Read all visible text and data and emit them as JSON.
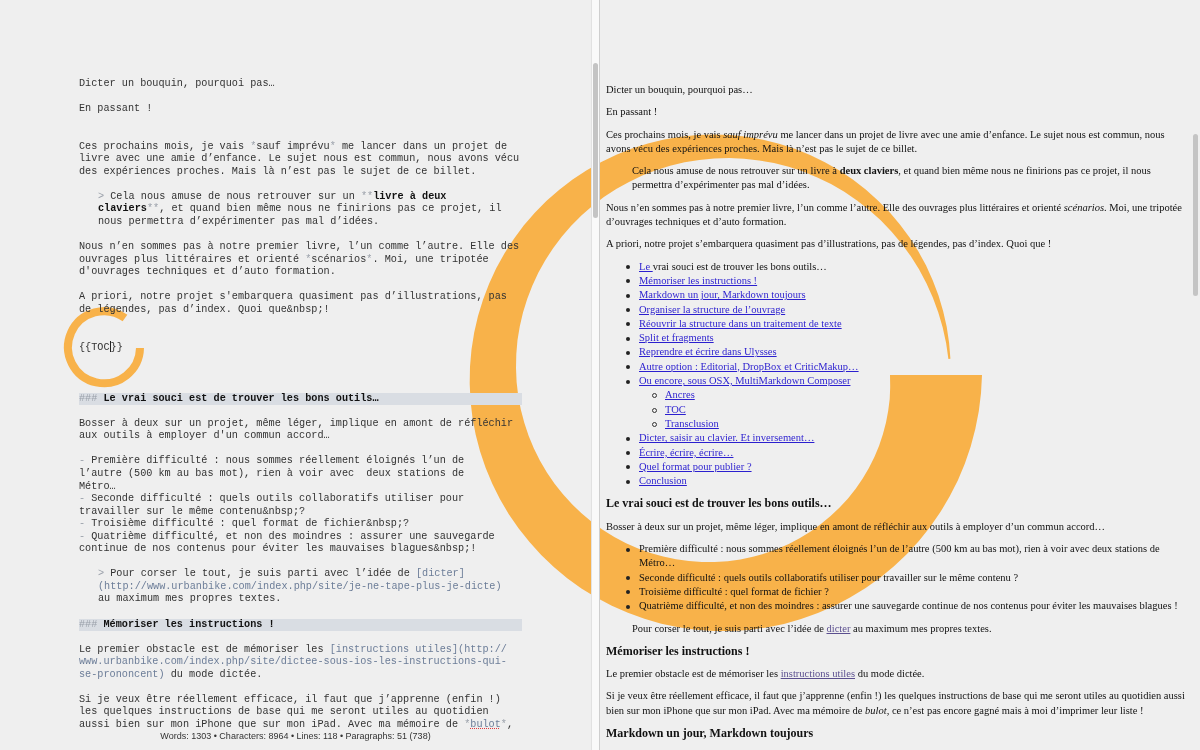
{
  "editor": {
    "blocks": [
      {
        "kind": "para",
        "lines": [
          "Dicter un bouquin, pourquoi pas…"
        ]
      },
      {
        "kind": "blank"
      },
      {
        "kind": "para",
        "lines": [
          "En passant !"
        ]
      },
      {
        "kind": "blank"
      },
      {
        "kind": "blank"
      },
      {
        "kind": "para",
        "lines": [
          [
            "Ces prochains mois, je vais ",
            {
              "text": "*",
              "kind": "mark"
            },
            "sauf imprévu",
            {
              "text": "*",
              "kind": "mark"
            },
            " me lancer dans un projet de"
          ],
          "livre avec une amie d’enfance. Le sujet nous est commun, nous avons vécu",
          "des expériences proches. Mais là n’est pas le sujet de ce billet."
        ]
      },
      {
        "kind": "blank"
      },
      {
        "kind": "quote",
        "lines": [
          [
            {
              "text": "> ",
              "kind": "mark"
            },
            "Cela nous amuse de nous retrouver sur un ",
            {
              "text": "**",
              "kind": "mark"
            },
            {
              "text": "livre à deux",
              "kind": "bold"
            }
          ],
          [
            {
              "text": "claviers",
              "kind": "bold"
            },
            {
              "text": "**",
              "kind": "mark"
            },
            ", et quand bien même nous ne finirions pas ce projet, il"
          ],
          "nous permettra d’expérimenter pas mal d’idées."
        ]
      },
      {
        "kind": "blank"
      },
      {
        "kind": "para",
        "lines": [
          "Nous n’en sommes pas à notre premier livre, l’un comme l’autre. Elle des",
          [
            "ouvrages plus littéraires et orienté ",
            {
              "text": "*",
              "kind": "mark"
            },
            "scénarios",
            {
              "text": "*",
              "kind": "mark"
            },
            ". Moi, une tripotée"
          ],
          "d'ouvrages techniques et d’auto formation."
        ]
      },
      {
        "kind": "blank"
      },
      {
        "kind": "para",
        "lines": [
          "A priori, notre projet s'embarquera quasiment pas d’illustrations, pas",
          "de légendes, pas d’index. Quoi que&nbsp;!"
        ]
      },
      {
        "kind": "blank"
      },
      {
        "kind": "blank"
      },
      {
        "kind": "para",
        "lines": [
          [
            "{{TOC",
            {
              "kind": "caret"
            },
            "}}"
          ]
        ]
      },
      {
        "kind": "blank"
      },
      {
        "kind": "blank"
      },
      {
        "kind": "blank"
      },
      {
        "kind": "heading",
        "lines": [
          [
            {
              "text": "### ",
              "kind": "mark"
            },
            {
              "text": "Le vrai souci est de trouver les bons outils…",
              "kind": "bold"
            }
          ]
        ]
      },
      {
        "kind": "blank"
      },
      {
        "kind": "para",
        "lines": [
          "Bosser à deux sur un projet, même léger, implique en amont de réfléchir",
          "aux outils à employer d'un commun accord…"
        ]
      },
      {
        "kind": "blank"
      },
      {
        "kind": "para",
        "lines": [
          [
            {
              "text": "- ",
              "kind": "mark"
            },
            "Première difficulté : nous sommes réellement éloignés l’un de"
          ],
          "l’autre (500 km au bas mot), rien à voir avec  deux stations de",
          "Métro…"
        ]
      },
      {
        "kind": "para",
        "lines": [
          [
            {
              "text": "- ",
              "kind": "mark"
            },
            "Seconde difficulté : quels outils collaboratifs utiliser pour"
          ],
          "travailler sur le même contenu&nbsp;?"
        ]
      },
      {
        "kind": "para",
        "lines": [
          [
            {
              "text": "- ",
              "kind": "mark"
            },
            "Troisième difficulté : quel format de fichier&nbsp;?"
          ]
        ]
      },
      {
        "kind": "para",
        "lines": [
          [
            {
              "text": "- ",
              "kind": "mark"
            },
            "Quatrième difficulté, et non des moindres : assurer une sauvegarde"
          ],
          "continue de nos contenus pour éviter les mauvaises blagues&nbsp;!"
        ]
      },
      {
        "kind": "blank"
      },
      {
        "kind": "quote",
        "lines": [
          [
            {
              "text": "> ",
              "kind": "mark"
            },
            "Pour corser le tout, je suis parti avec l’idée de ",
            {
              "text": "[dicter]",
              "kind": "link"
            }
          ],
          [
            {
              "text": "(http://www.urbanbike.com/index.php/site/je-ne-tape-plus-je-dicte)",
              "kind": "link"
            }
          ],
          "au maximum mes propres textes."
        ]
      },
      {
        "kind": "blank"
      },
      {
        "kind": "heading",
        "lines": [
          [
            {
              "text": "### ",
              "kind": "mark"
            },
            {
              "text": "Mémoriser les instructions !",
              "kind": "bold"
            }
          ]
        ]
      },
      {
        "kind": "blank"
      },
      {
        "kind": "para",
        "lines": [
          [
            "Le premier obstacle est de mémoriser les ",
            {
              "text": "[instructions utiles](http://",
              "kind": "link"
            }
          ],
          [
            {
              "text": "www.urbanbike.com/index.php/site/dictee-sous-ios-les-instructions-qui-",
              "kind": "link"
            }
          ],
          [
            {
              "text": "se-prononcent)",
              "kind": "link"
            },
            " du mode dictée."
          ]
        ]
      },
      {
        "kind": "blank"
      },
      {
        "kind": "para",
        "lines": [
          "Si je veux être réellement efficace, il faut que j’apprenne (enfin !)",
          "les quelques instructions de base qui me seront utiles au quotidien",
          [
            "aussi bien sur mon iPhone que sur mon iPad. Avec ma mémoire de ",
            {
              "text": "*",
              "kind": "mark"
            },
            {
              "text": "bulot",
              "kind": "misspelled"
            },
            {
              "text": "*",
              "kind": "mark"
            },
            ","
          ]
        ]
      }
    ]
  },
  "status_bar": {
    "text": "Words: 1303 • Characters: 8964 • Lines: 118 • Paragraphs: 51 (738)"
  },
  "preview": {
    "blocks": [
      {
        "kind": "para",
        "segments": [
          "Dicter un bouquin, pourquoi pas…"
        ]
      },
      {
        "kind": "para",
        "segments": [
          "En passant !"
        ]
      },
      {
        "kind": "para",
        "segments": [
          "Ces prochains mois, je vais ",
          {
            "text": "sauf imprévu",
            "kind": "italic"
          },
          " me lancer dans un projet de livre avec une amie d’enfance. Le sujet nous est commun, nous avons vécu des expériences proches. Mais là n’est pas le sujet de ce billet."
        ]
      },
      {
        "kind": "quote",
        "segments": [
          "Cela nous amuse de nous retrouver sur un livre à ",
          {
            "text": "deux claviers",
            "kind": "bold"
          },
          ", et quand bien même nous ne finirions pas ce projet, il nous permettra d’expérimenter pas mal d’idées."
        ]
      },
      {
        "kind": "para",
        "segments": [
          "Nous n’en sommes pas à notre premier livre, l’un comme l’autre. Elle des ouvrages plus littéraires et orienté ",
          {
            "text": "scénarios",
            "kind": "italic"
          },
          ". Moi, une tripotée d’ouvrages techniques et d’auto formation."
        ]
      },
      {
        "kind": "para",
        "segments": [
          "A priori, notre projet s’embarquera quasiment pas d’illustrations, pas de légendes, pas d’index. Quoi que !"
        ]
      },
      {
        "kind": "list",
        "items": [
          {
            "segments": [
              {
                "text": "Le ",
                "kind": "link"
              },
              "vrai souci est de trouver les bons outils…"
            ]
          },
          {
            "segments": [
              {
                "text": "Mémoriser les instructions !",
                "kind": "link"
              }
            ]
          },
          {
            "segments": [
              {
                "text": "Markdown un jour, Markdown toujours",
                "kind": "link"
              }
            ]
          },
          {
            "segments": [
              {
                "text": "Organiser la structure de l’ouvrage",
                "kind": "link"
              }
            ]
          },
          {
            "segments": [
              {
                "text": "Réouvrir la structure dans un traitement de texte",
                "kind": "link"
              }
            ]
          },
          {
            "segments": [
              {
                "text": "Split et fragments",
                "kind": "link"
              }
            ]
          },
          {
            "segments": [
              {
                "text": "Reprendre et écrire dans Ulysses",
                "kind": "link"
              }
            ]
          },
          {
            "segments": [
              {
                "text": "Autre option : Editorial, DropBox et CriticMakup…",
                "kind": "link"
              }
            ]
          },
          {
            "segments": [
              {
                "text": "Ou encore, sous OSX, MultiMarkdown Composer",
                "kind": "link"
              }
            ],
            "children": [
              {
                "segments": [
                  {
                    "text": "Ancres",
                    "kind": "link"
                  }
                ]
              },
              {
                "segments": [
                  {
                    "text": "TOC",
                    "kind": "link"
                  }
                ]
              },
              {
                "segments": [
                  {
                    "text": "Transclusion",
                    "kind": "link"
                  }
                ]
              }
            ]
          },
          {
            "segments": [
              {
                "text": "Dicter, saisir au clavier. Et inversement…",
                "kind": "link"
              }
            ]
          },
          {
            "segments": [
              {
                "text": "Écrire, écrire, écrire…",
                "kind": "link"
              }
            ]
          },
          {
            "segments": [
              {
                "text": "Quel format pour publier ?",
                "kind": "link"
              }
            ]
          },
          {
            "segments": [
              {
                "text": "Conclusion",
                "kind": "link"
              }
            ]
          }
        ]
      },
      {
        "kind": "heading",
        "segments": [
          "Le vrai souci est de trouver les bons outils…"
        ]
      },
      {
        "kind": "para",
        "segments": [
          "Bosser à deux sur un projet, même léger, implique en amont de réfléchir aux outils à employer d’un commun accord…"
        ]
      },
      {
        "kind": "list",
        "items": [
          {
            "segments": [
              "Première difficulté : nous sommes réellement éloignés l’un de l’autre (500 km au bas mot), rien à voir avec deux stations de Métro…"
            ]
          },
          {
            "segments": [
              "Seconde difficulté : quels outils collaboratifs utiliser pour travailler sur le même contenu ?"
            ]
          },
          {
            "segments": [
              "Troisième difficulté : quel format de fichier ?"
            ]
          },
          {
            "segments": [
              "Quatrième difficulté, et non des moindres : assurer une sauvegarde continue de nos contenus pour éviter les mauvaises blagues !"
            ]
          }
        ]
      },
      {
        "kind": "quote",
        "segments": [
          "Pour corser le tout, je suis parti avec l’idée de ",
          {
            "text": "dicter",
            "kind": "visited"
          },
          " au maximum mes propres textes."
        ]
      },
      {
        "kind": "heading",
        "segments": [
          "Mémoriser les instructions !"
        ]
      },
      {
        "kind": "para",
        "segments": [
          "Le premier obstacle est de mémoriser les ",
          {
            "text": "instructions utiles",
            "kind": "visited"
          },
          " du mode dictée."
        ]
      },
      {
        "kind": "para",
        "segments": [
          "Si je veux être réellement efficace, il faut que j’apprenne (enfin !) les quelques instructions de base qui me seront utiles au quotidien aussi bien sur mon iPhone que sur mon iPad. Avec ma mémoire de ",
          {
            "text": "bulot",
            "kind": "italic"
          },
          ", ce n’est pas encore gagné mais à moi d’imprimer leur liste !"
        ]
      },
      {
        "kind": "heading",
        "segments": [
          "Markdown un jour, Markdown toujours"
        ]
      }
    ]
  }
}
